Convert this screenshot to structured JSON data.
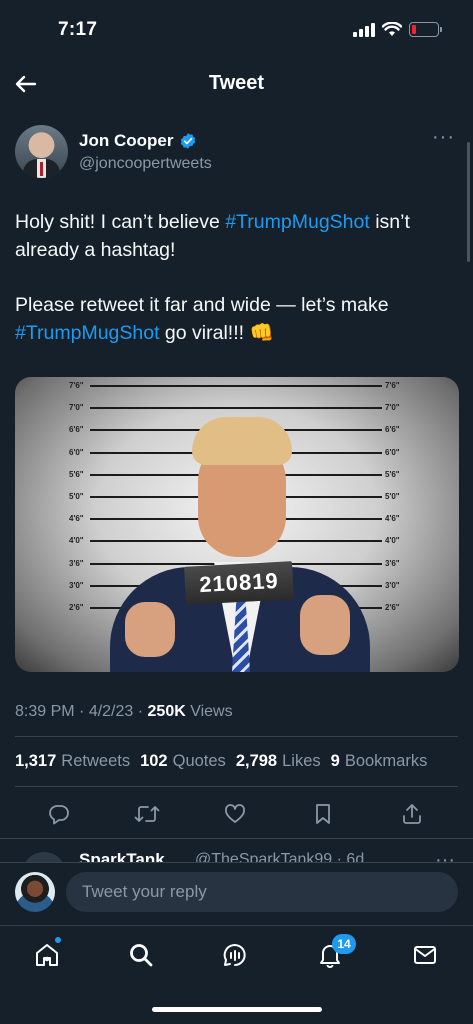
{
  "status_bar": {
    "time": "7:17"
  },
  "header": {
    "title": "Tweet"
  },
  "tweet": {
    "author_name": "Jon Cooper",
    "author_handle": "@joncoopertweets",
    "text_p1_a": "Holy shit! I can’t believe ",
    "text_p1_tag": "#TrumpMugShot",
    "text_p1_b": " isn’t already a hashtag!",
    "text_p2_a": "Please retweet it far and wide — let’s make ",
    "text_p2_tag": "#TrumpMugShot",
    "text_p2_b": " go viral!!! 👊",
    "media": {
      "placard": "210819",
      "height_marks": [
        "7'6\"",
        "7'0\"",
        "6'6\"",
        "6'0\"",
        "5'6\"",
        "5'0\"",
        "4'6\"",
        "4'0\"",
        "3'6\"",
        "3'0\"",
        "2'6\""
      ]
    },
    "time": "8:39 PM",
    "date": "4/2/23",
    "views_count": "250K",
    "views_label": "Views",
    "stats": [
      {
        "count": "1,317",
        "label": "Retweets"
      },
      {
        "count": "102",
        "label": "Quotes"
      },
      {
        "count": "2,798",
        "label": "Likes"
      },
      {
        "count": "9",
        "label": "Bookmarks"
      }
    ]
  },
  "next_reply": {
    "name": "SparkTank",
    "handle": "@TheSparkTank99 · 6d"
  },
  "composer": {
    "placeholder": "Tweet your reply"
  },
  "nav": {
    "notifications_badge": "14"
  },
  "icons": {
    "back": "arrow-left-icon",
    "verified": "verified-badge-icon",
    "more": "more-horizontal-icon",
    "reply": "reply-icon",
    "retweet": "retweet-icon",
    "like": "heart-icon",
    "bookmark": "bookmark-icon",
    "share": "share-icon",
    "home": "home-icon",
    "search": "search-icon",
    "spaces": "spaces-icon",
    "notifications": "bell-icon",
    "messages": "mail-icon"
  },
  "colors": {
    "background": "#15202b",
    "accent": "#1d9bf0",
    "muted": "#8b98a5",
    "battery_low": "#f4212e"
  }
}
